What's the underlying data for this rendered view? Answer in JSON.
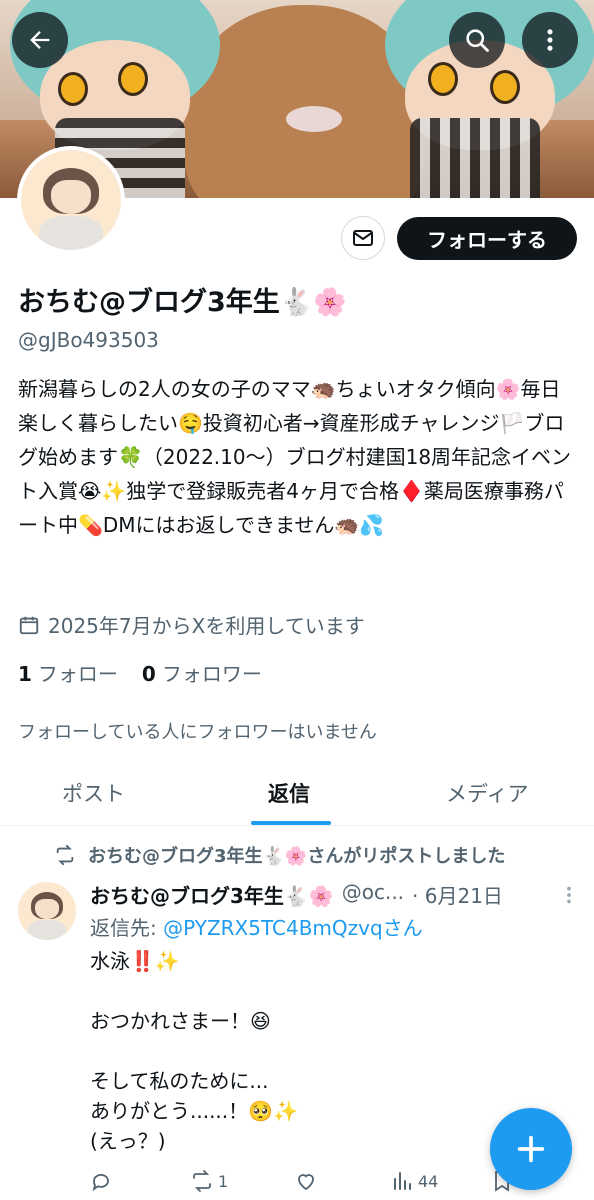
{
  "profile": {
    "name": "おちむ@ブログ3年生🐇🌸",
    "handle": "@gJBo493503",
    "bio": "新潟暮らしの2人の女の子のママ🦔ちょいオタク傾向🌸毎日楽しく暮らしたい🤤投資初心者→資産形成チャレンジ🏳️ブログ始めます🍀（2022.10〜）ブログ村建国18周年記念イベント入賞😭✨独学で登録販売者4ヶ月で合格♦️薬局医療事務パート中💊DMにはお返しできません🦔💦",
    "joined": "2025年7月からXを利用しています",
    "following_count": "1",
    "following_label": "フォロー",
    "followers_count": "0",
    "followers_label": "フォロワー",
    "mutual_note": "フォローしている人にフォロワーはいません",
    "follow_button": "フォローする"
  },
  "tabs": [
    {
      "label": "ポスト",
      "active": false
    },
    {
      "label": "返信",
      "active": true
    },
    {
      "label": "メディア",
      "active": false
    }
  ],
  "tweet": {
    "repost_note": "おちむ@ブログ3年生🐇🌸さんがリポストしました",
    "author_name": "おちむ@ブログ3年生🐇🌸",
    "author_handle_trunc": "@oc...",
    "date": "· 6月21日",
    "reply_prefix": "返信先:",
    "reply_to": "@PYZRX5TC4BmQzvqさん",
    "body": "水泳‼️✨\n\nおつかれさまー！😆\n\nそして私のために...\nありがとう......！🥺✨\n(えっ？)",
    "retweet_count": "1",
    "views_count": "44"
  },
  "icons": [
    "back-arrow-icon",
    "search-icon",
    "more-vertical-icon",
    "mail-icon",
    "calendar-icon",
    "repost-icon",
    "reply-icon",
    "retweet-icon",
    "like-icon",
    "views-icon",
    "bookmark-icon",
    "plus-icon"
  ],
  "colors": {
    "accent": "#1d9bf0",
    "text": "#0f1419",
    "muted": "#536471"
  }
}
